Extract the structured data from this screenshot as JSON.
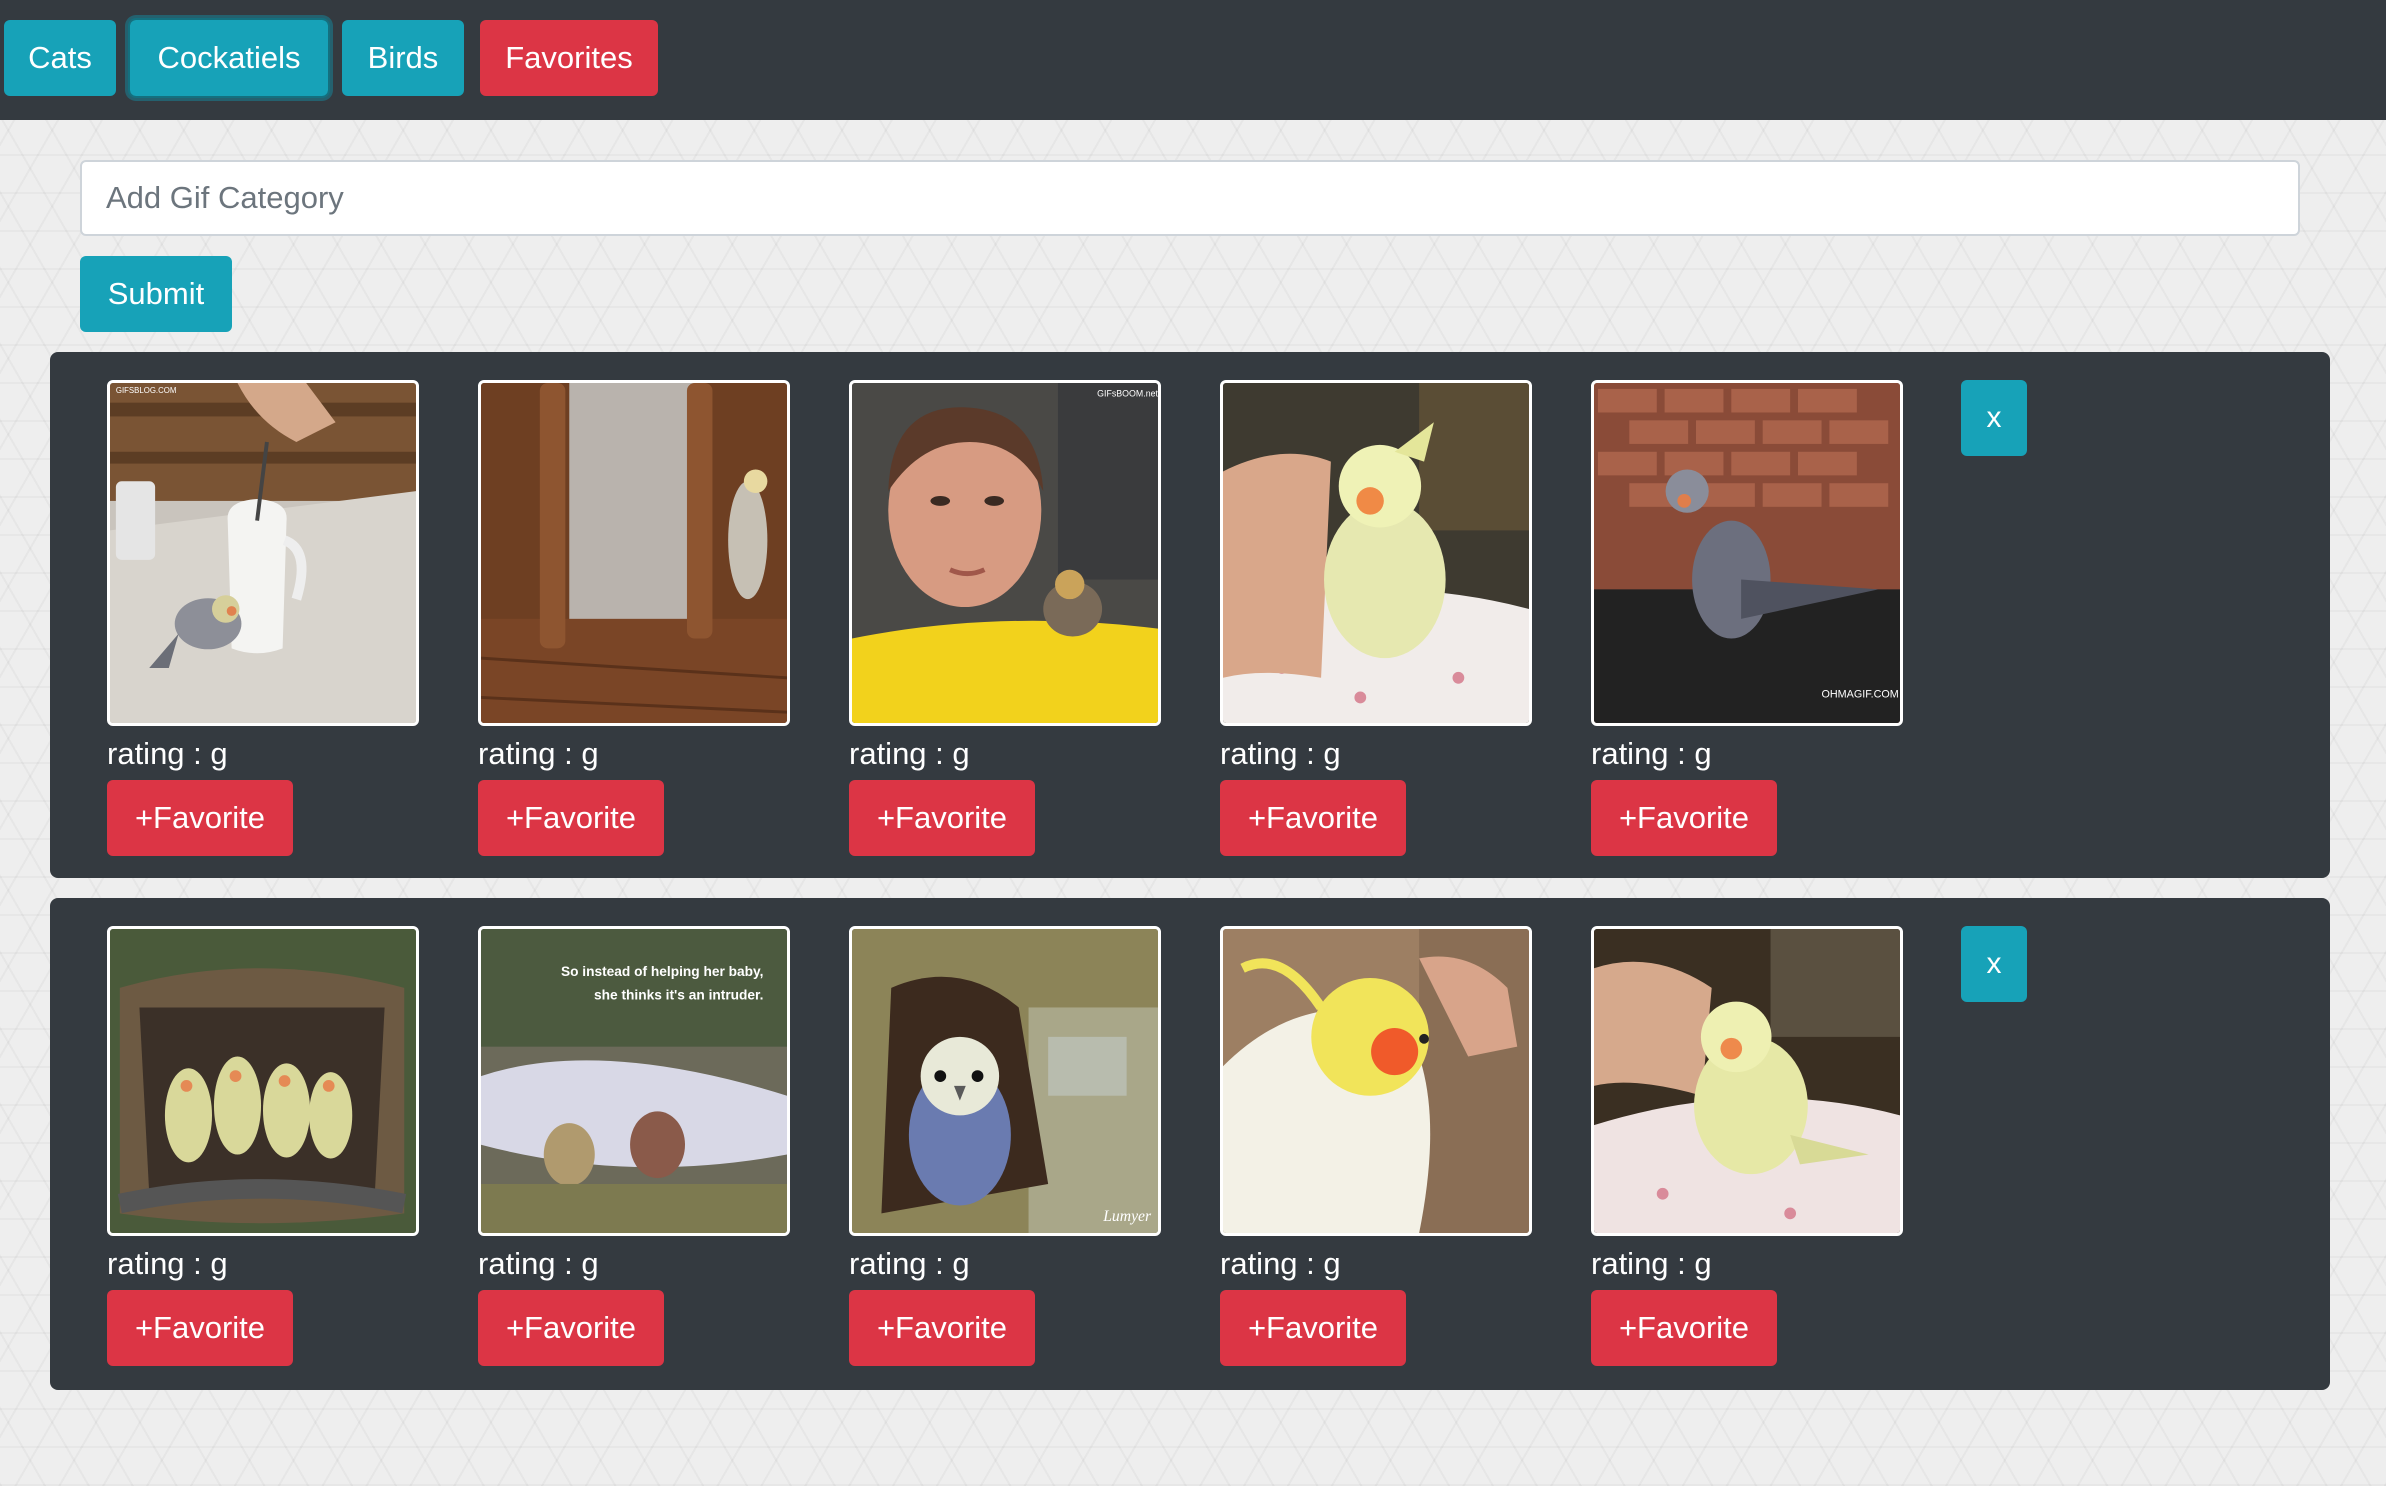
{
  "nav": {
    "cats": "Cats",
    "cockatiels": "Cockatiels",
    "birds": "Birds",
    "favorites": "Favorites"
  },
  "form": {
    "placeholder": "Add Gif Category",
    "submit": "Submit"
  },
  "panels": [
    {
      "close_label": "x",
      "gifs": [
        {
          "rating": "rating : g",
          "favorite": "+Favorite",
          "watermark": "GIFSBLOG.COM"
        },
        {
          "rating": "rating : g",
          "favorite": "+Favorite"
        },
        {
          "rating": "rating : g",
          "favorite": "+Favorite",
          "watermark": "GIFsBOOM.net"
        },
        {
          "rating": "rating : g",
          "favorite": "+Favorite"
        },
        {
          "rating": "rating : g",
          "favorite": "+Favorite",
          "watermark": "OHMAGIF.COM"
        }
      ]
    },
    {
      "close_label": "x",
      "gifs": [
        {
          "rating": "rating : g",
          "favorite": "+Favorite"
        },
        {
          "rating": "rating : g",
          "favorite": "+Favorite",
          "caption_line1": "So instead of helping her baby,",
          "caption_line2": "she thinks it's an intruder."
        },
        {
          "rating": "rating : g",
          "favorite": "+Favorite",
          "watermark": "Lumyer"
        },
        {
          "rating": "rating : g",
          "favorite": "+Favorite"
        },
        {
          "rating": "rating : g",
          "favorite": "+Favorite"
        }
      ]
    }
  ],
  "colors": {
    "navbar": "#343a40",
    "info": "#17a2b8",
    "danger": "#dc3545"
  }
}
